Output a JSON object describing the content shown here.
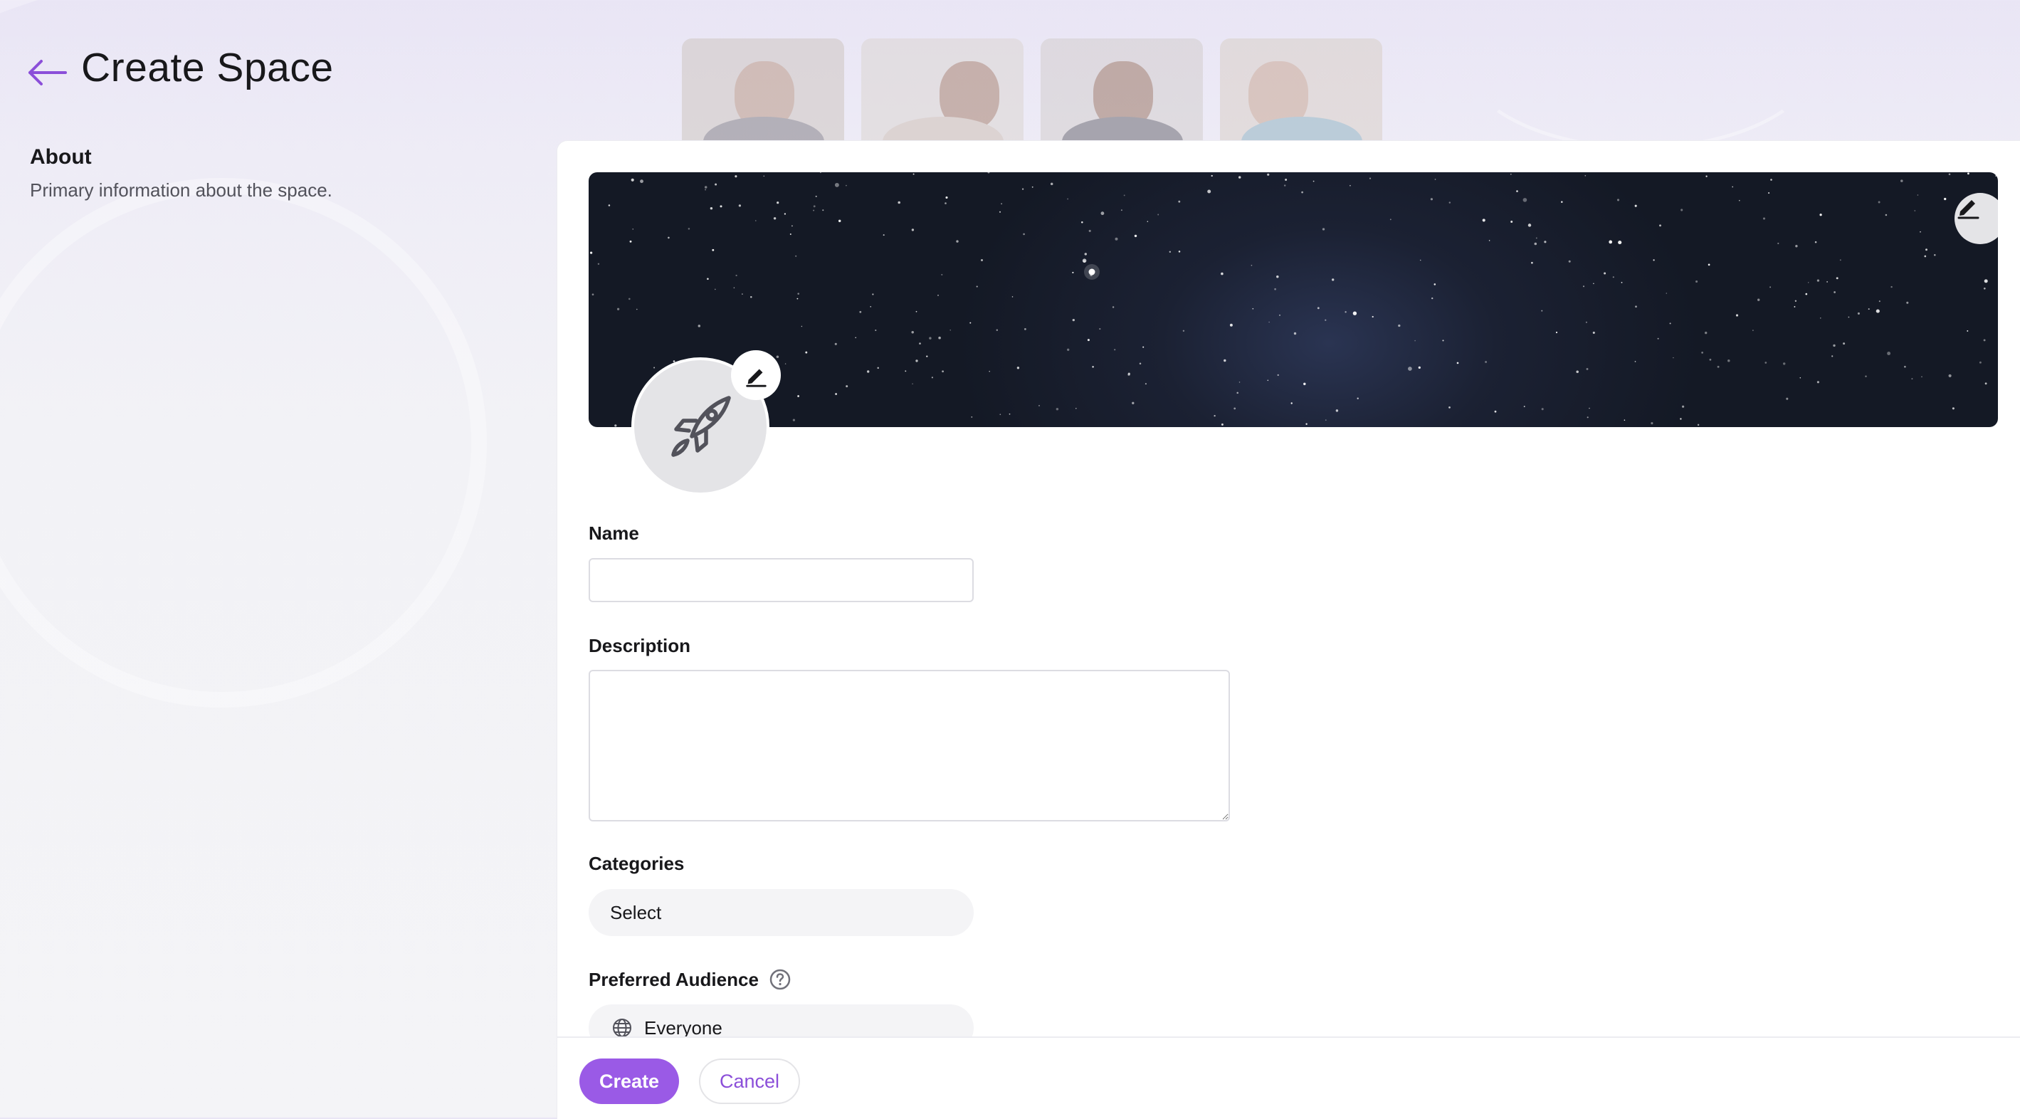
{
  "header": {
    "title": "Create Space",
    "back_icon": "arrow-left-icon"
  },
  "about": {
    "title": "About",
    "description": "Primary information about the space."
  },
  "form": {
    "banner_edit_icon": "pencil-icon",
    "avatar_icon": "rocket-icon",
    "avatar_edit_icon": "pencil-icon",
    "name": {
      "label": "Name",
      "value": "",
      "placeholder": ""
    },
    "description": {
      "label": "Description",
      "value": "",
      "placeholder": ""
    },
    "categories": {
      "label": "Categories",
      "selected": "Select"
    },
    "audience": {
      "label": "Preferred Audience",
      "help_icon": "question-circle-icon",
      "selected": "Everyone",
      "option_icon": "globe-icon"
    }
  },
  "footer": {
    "create_label": "Create",
    "cancel_label": "Cancel"
  },
  "colors": {
    "accent": "#9a5ae6",
    "accent_text": "#8b4fd9",
    "banner": "#161b27"
  }
}
